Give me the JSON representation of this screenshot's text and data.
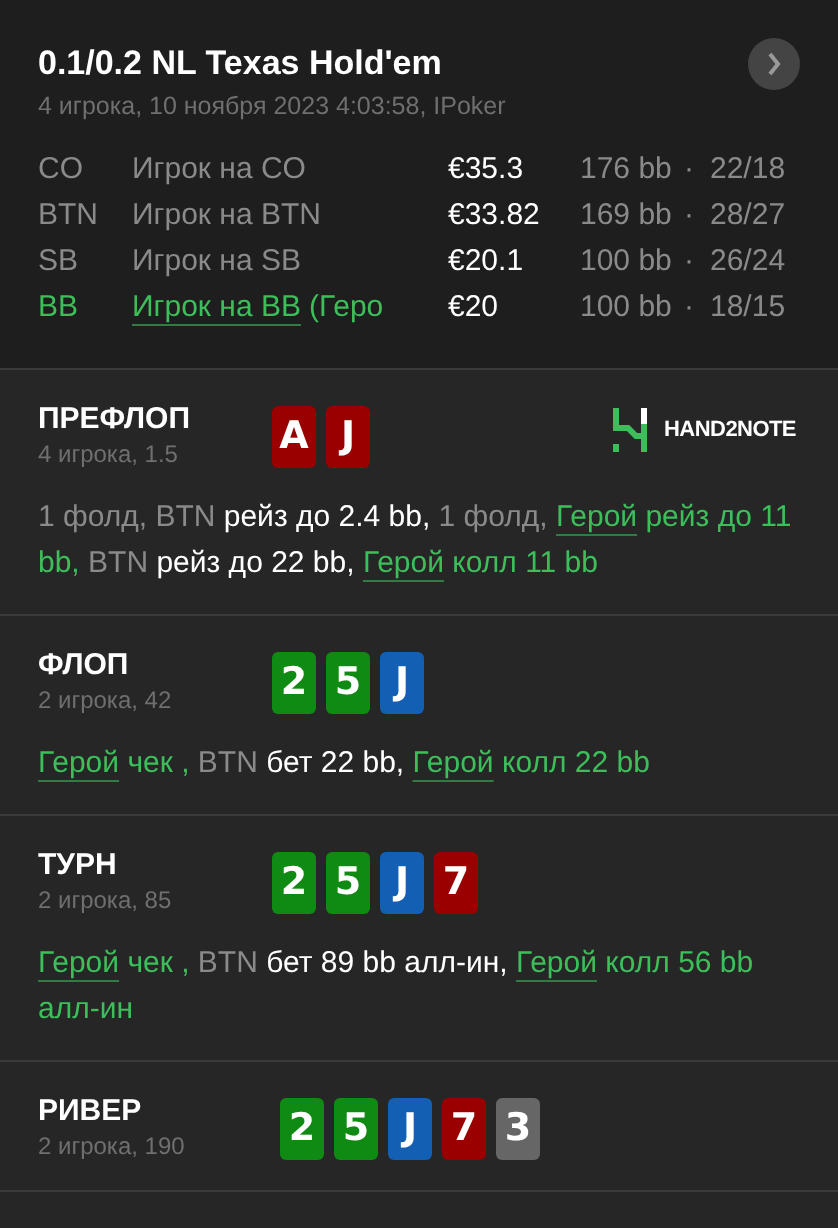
{
  "header": {
    "title": "0.1/0.2 NL Texas Hold'em",
    "subtitle": "4 игрока, 10 ноября 2023 4:03:58, IPoker"
  },
  "players": [
    {
      "position": "CO",
      "name": "Игрок на CO",
      "stack": "€35.3",
      "bb": "176 bb",
      "separator": "·",
      "record": "22/18",
      "hero": false
    },
    {
      "position": "BTN",
      "name": "Игрок на BTN",
      "stack": "€33.82",
      "bb": "169 bb",
      "separator": "·",
      "record": "28/27",
      "hero": false
    },
    {
      "position": "SB",
      "name": "Игрок на SB",
      "stack": "€20.1",
      "bb": "100 bb",
      "separator": "·",
      "record": "26/24",
      "hero": false
    },
    {
      "position": "BB",
      "name": "Игрок на BB",
      "suffix": "(Геро",
      "stack": "€20",
      "bb": "100 bb",
      "separator": "·",
      "record": "18/15",
      "hero": true
    }
  ],
  "streets": [
    {
      "title": "ПРЕФЛОП",
      "subtitle": "4 игрока, 1.5",
      "logo": "HAND2NOTE",
      "cards": [
        {
          "rank": "A",
          "color": "#9a0000"
        },
        {
          "rank": "J",
          "color": "#9a0000"
        }
      ],
      "actions": [
        {
          "kind": "muted",
          "text": "1 фолд, BTN "
        },
        {
          "kind": "action",
          "text": "рейз до 2.4 bb, "
        },
        {
          "kind": "muted",
          "text": "1 фолд, "
        },
        {
          "kind": "hero_link",
          "text": "Герой"
        },
        {
          "kind": "hero",
          "text": " рейз до 11 bb, "
        },
        {
          "kind": "muted",
          "text": "BTN "
        },
        {
          "kind": "action",
          "text": "рейз до 22 bb, "
        },
        {
          "kind": "hero_link",
          "text": "Герой"
        },
        {
          "kind": "hero",
          "text": " колл 11 bb"
        }
      ]
    },
    {
      "title": "ФЛОП",
      "subtitle": "2 игрока, 42",
      "cards": [
        {
          "rank": "2",
          "color": "#0f8a12"
        },
        {
          "rank": "5",
          "color": "#0f8a12"
        },
        {
          "rank": "J",
          "color": "#125fb4"
        }
      ],
      "actions": [
        {
          "kind": "hero_link",
          "text": "Герой"
        },
        {
          "kind": "hero",
          "text": " чек , "
        },
        {
          "kind": "muted",
          "text": "BTN "
        },
        {
          "kind": "action",
          "text": "бет 22 bb, "
        },
        {
          "kind": "hero_link",
          "text": "Герой"
        },
        {
          "kind": "hero",
          "text": " колл 22 bb"
        }
      ]
    },
    {
      "title": "ТУРН",
      "subtitle": "2 игрока, 85",
      "cards": [
        {
          "rank": "2",
          "color": "#0f8a12"
        },
        {
          "rank": "5",
          "color": "#0f8a12"
        },
        {
          "rank": "J",
          "color": "#125fb4"
        },
        {
          "rank": "7",
          "color": "#9a0000"
        }
      ],
      "actions": [
        {
          "kind": "hero_link",
          "text": "Герой"
        },
        {
          "kind": "hero",
          "text": " чек , "
        },
        {
          "kind": "muted",
          "text": "BTN "
        },
        {
          "kind": "action",
          "text": "бет 89 bb алл-ин, "
        },
        {
          "kind": "hero_link",
          "text": "Герой"
        },
        {
          "kind": "hero",
          "text": " колл 56 bb алл-ин"
        }
      ]
    },
    {
      "title": "РИВЕР",
      "subtitle": "2 игрока, 190",
      "cards": [
        {
          "rank": "2",
          "color": "#0f8a12"
        },
        {
          "rank": "5",
          "color": "#0f8a12"
        },
        {
          "rank": "J",
          "color": "#125fb4"
        },
        {
          "rank": "7",
          "color": "#9a0000"
        },
        {
          "rank": "3",
          "color": "#666666"
        }
      ]
    }
  ]
}
